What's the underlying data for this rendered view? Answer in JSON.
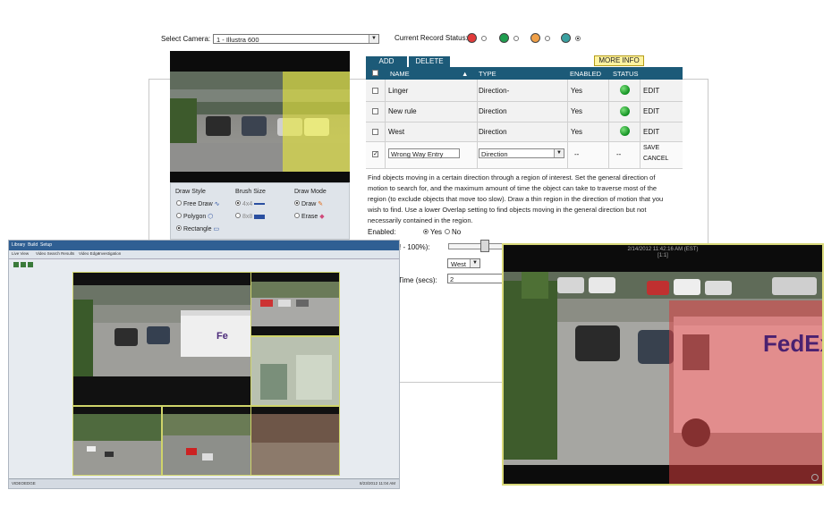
{
  "header": {
    "select_camera_label": "Select Camera:",
    "camera_value": "1 - Illustra 600",
    "record_status_label": "Current Record Status:"
  },
  "record_status": [
    {
      "color": "#e23a3a",
      "selected": false
    },
    {
      "color": "#1f9e4f",
      "selected": false
    },
    {
      "color": "#f0a048",
      "selected": false
    },
    {
      "color": "#3aa0a0",
      "selected": true
    }
  ],
  "preview": {
    "caption": ""
  },
  "tools": {
    "draw_style": {
      "title": "Draw Style",
      "options": [
        "Free Draw",
        "Polygon",
        "Rectangle"
      ],
      "selected": "Rectangle"
    },
    "brush_size": {
      "title": "Brush Size",
      "options": [
        "4x4",
        "8x8"
      ],
      "selected": "4x4"
    },
    "draw_mode": {
      "title": "Draw Mode",
      "options": [
        "Draw",
        "Erase"
      ],
      "selected": "Draw"
    }
  },
  "rules": {
    "add_label": "ADD",
    "delete_label": "DELETE",
    "more_info_label": "MORE INFO",
    "columns": {
      "name": "NAME",
      "type": "TYPE",
      "enabled": "ENABLED",
      "status": "STATUS"
    },
    "rows": [
      {
        "name": "Linger",
        "type": "Direction-",
        "enabled": "Yes",
        "action": "EDIT",
        "checked": false
      },
      {
        "name": "New rule",
        "type": "Direction",
        "enabled": "Yes",
        "action": "EDIT",
        "checked": false
      },
      {
        "name": "West",
        "type": "Direction",
        "enabled": "Yes",
        "action": "EDIT",
        "checked": false
      }
    ],
    "edit_row": {
      "name_value": "Wrong Way Entry",
      "type_value": "Direction",
      "enabled": "--",
      "status": "--",
      "save_label": "SAVE",
      "cancel_label": "CANCEL",
      "checked": true
    }
  },
  "description": "Find objects moving in a certain direction through a region of interest. Set the general direction of motion to search for, and the maximum amount of time the object can take to traverse most of the region (to exclude objects that move too slow). Draw a thin region in the direction of motion that you wish to find. Use a lower Overlap setting to find objects moving in the general direction but not necessarily contained in the region.",
  "form": {
    "enabled_label": "Enabled:",
    "yes_label": "Yes",
    "no_label": "No",
    "overlap_label": "! - 100%):",
    "direction_value": "West",
    "time_label": "Time (secs):",
    "time_value": "2"
  },
  "zoom": {
    "timestamp": "2/14/2012 11:42:16 AM (EST)",
    "camera_id": "[1:1]",
    "truck_text": "FedEx"
  },
  "client": {
    "menu": [
      "Library",
      "Build",
      "Setup"
    ],
    "tabs": [
      "Live View",
      "Video Search Results",
      "Video Edge",
      "Investigation"
    ],
    "status_left": "VIDEOEDGE",
    "status_right": "8/23/2012 11:04 AM"
  }
}
